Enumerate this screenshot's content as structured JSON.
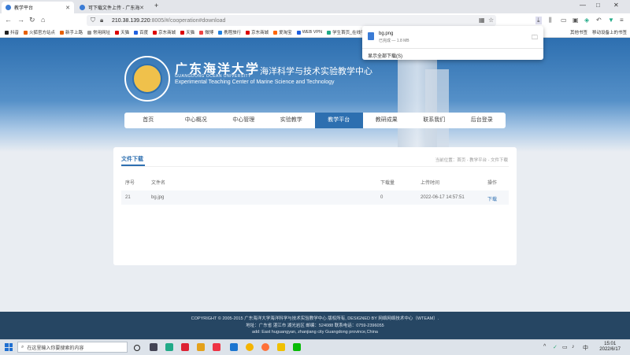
{
  "browser": {
    "tabs": [
      {
        "title": "教学平台"
      },
      {
        "title": "可下载文件上传 - 广东海洋大学"
      }
    ],
    "new_tab": "+",
    "url_main": "210.38.139.220",
    "url_rest": ":8005/#/cooperation#download",
    "bookmarks": [
      "抖音",
      "火狐官方站点",
      "新手上路",
      "常用网址",
      "天猫",
      "百度",
      "京东商城",
      "天猫",
      "微博",
      "携程旅行",
      "京东商城",
      "爱淘宝",
      "WEB VPN",
      "学生首页_在线学堂...",
      "其他书签",
      "移动设备上的书签"
    ]
  },
  "downloads": {
    "file_name": "bg.png",
    "status": "已完成 — 1.8 MB",
    "show_all": "显示全部下载(S)"
  },
  "header": {
    "school_cn": "广东海洋大学",
    "school_en": "GUANGDONG OCEAN UNIVERSITY",
    "center_cn": "海洋科学与技术实验教学中心",
    "center_en": "Experimental Teaching Center of Marine Science and Technology"
  },
  "nav": {
    "items": [
      "首页",
      "中心概况",
      "中心管理",
      "实验教学",
      "教学平台",
      "教研成果",
      "联系我们",
      "后台登录"
    ],
    "active": "教学平台"
  },
  "content": {
    "title": "文件下载",
    "breadcrumb": "当前位置：首页 - 教学平台 - 文件下载",
    "columns": [
      "序号",
      "文件名",
      "下载量",
      "上传时间",
      "操作"
    ],
    "rows": [
      {
        "id": "21",
        "file": "bg.jpg",
        "downloads": "0",
        "time": "2022-06-17 14:57:51",
        "action": "下载"
      }
    ]
  },
  "footer": {
    "line1": "COPYRIGHT © 2005-2015 广东海洋大学海洋科学与技术实验教学中心 版权所有, DESIGNED BY 网络网络技术中心（WTEAM）.",
    "line2": "地址：广东省 湛江市 湖光岩区 邮编：524088 联系电话：0759-2396055",
    "line3": "add: East huguangyan, zhanjiang city Guangdong province,China"
  },
  "taskbar": {
    "search_placeholder": "在这里输入你要搜索的内容",
    "time": "15:01",
    "date": "2022/6/17",
    "lang": "中"
  }
}
